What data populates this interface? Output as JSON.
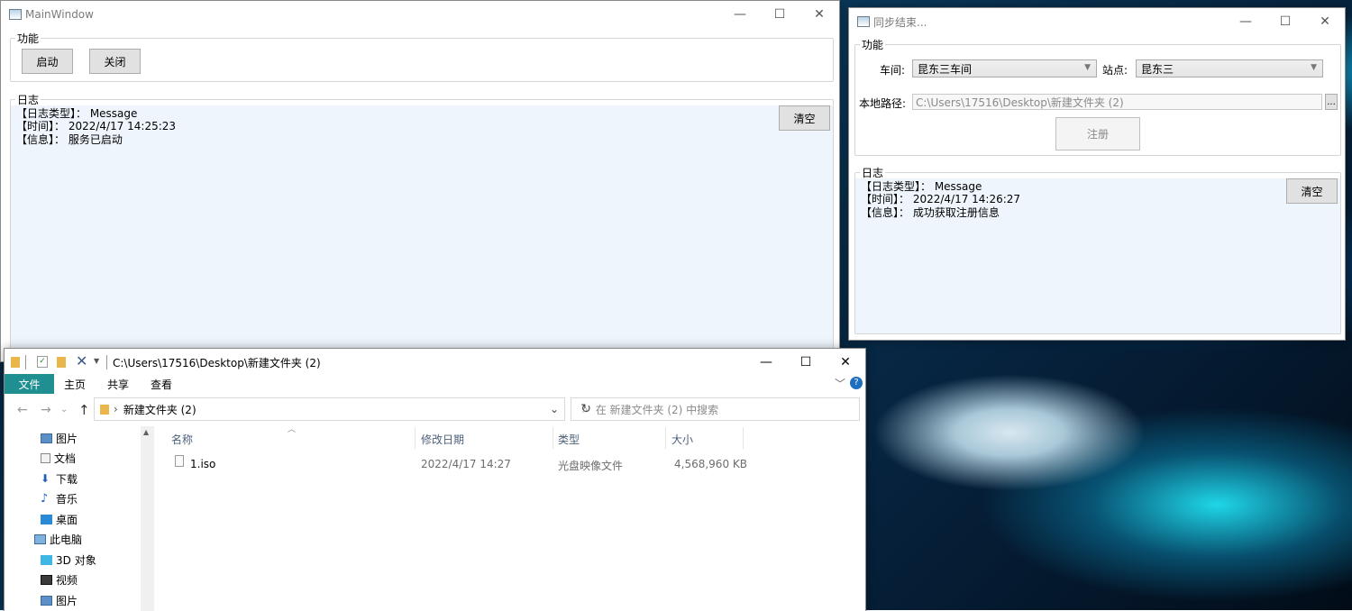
{
  "main_window": {
    "title": "MainWindow",
    "func_group": "功能",
    "start_button": "启动",
    "close_button": "关闭",
    "log_group": "日志",
    "clear_button": "清空",
    "log_lines": [
      "【日志类型】： Message",
      "【时间】： 2022/4/17 14:25:23",
      "【信息】： 服务已启动"
    ]
  },
  "sync_window": {
    "title": "同步结束...",
    "func_group": "功能",
    "workshop_label": "车间:",
    "workshop_value": "昆东三车间",
    "station_label": "站点:",
    "station_value": "昆东三",
    "path_label": "本地路径:",
    "path_value": "C:\\Users\\17516\\Desktop\\新建文件夹 (2)",
    "browse_button": "...",
    "register_button": "注册",
    "log_group": "日志",
    "clear_button": "清空",
    "log_lines": [
      "【日志类型】： Message",
      "【时间】： 2022/4/17 14:26:27",
      "【信息】： 成功获取注册信息"
    ]
  },
  "explorer": {
    "title_path": "C:\\Users\\17516\\Desktop\\新建文件夹 (2)",
    "tabs": [
      "文件",
      "主页",
      "共享",
      "查看"
    ],
    "breadcrumb": "新建文件夹 (2)",
    "search_placeholder": "在 新建文件夹 (2) 中搜索",
    "nav_items": [
      "图片",
      "文档",
      "下载",
      "音乐",
      "桌面",
      "此电脑",
      "3D 对象",
      "视频",
      "图片"
    ],
    "columns": [
      "名称",
      "修改日期",
      "类型",
      "大小"
    ],
    "files": [
      {
        "name": "1.iso",
        "date": "2022/4/17 14:27",
        "type": "光盘映像文件",
        "size": "4,568,960 KB"
      }
    ],
    "help": "?"
  },
  "colors": {
    "ribbon_active": "#1f8f91",
    "log_bg": "#eef5fc",
    "help": "#1e6fc2"
  },
  "icons": [
    "window-icon",
    "minimize-icon",
    "maximize-icon",
    "close-icon",
    "folder-icon",
    "refresh-icon",
    "search-icon",
    "back-icon",
    "forward-icon",
    "up-icon",
    "iso-file-icon"
  ]
}
